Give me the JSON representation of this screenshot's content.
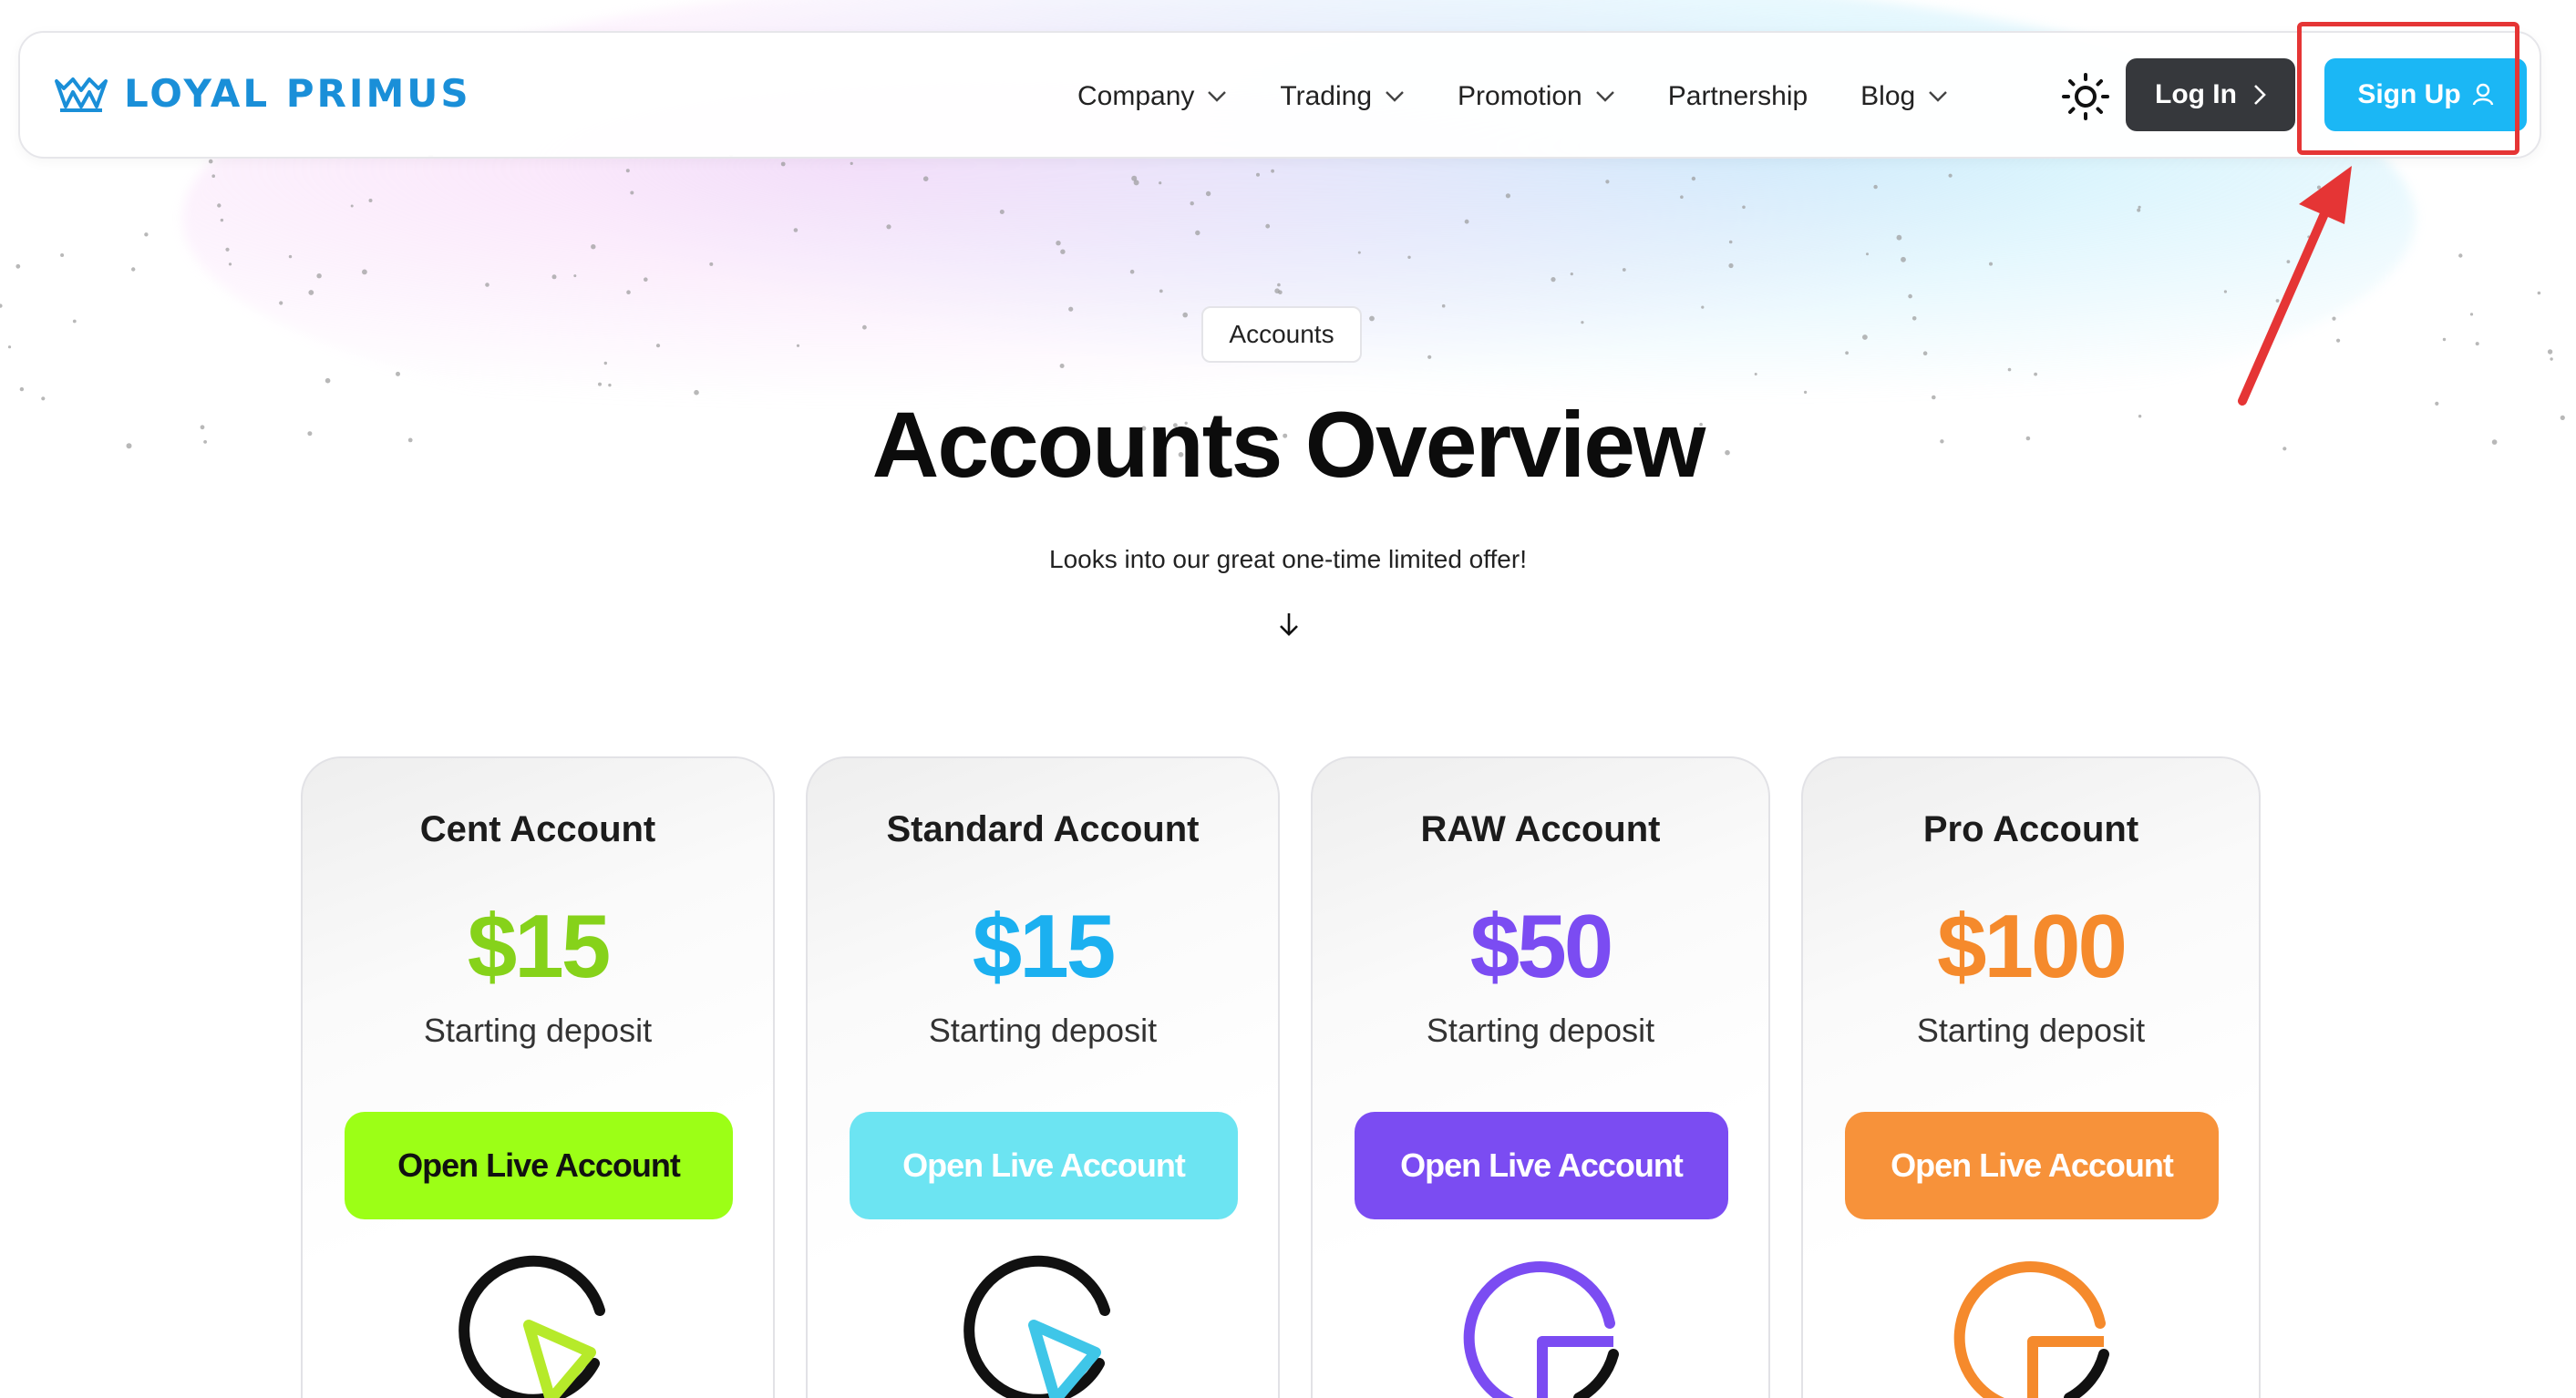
{
  "brand": {
    "name": "LOYAL PRIMUS",
    "color": "#1a8fd8"
  },
  "nav": {
    "items": [
      {
        "label": "Company",
        "has_dropdown": true
      },
      {
        "label": "Trading",
        "has_dropdown": true
      },
      {
        "label": "Promotion",
        "has_dropdown": true
      },
      {
        "label": "Partnership",
        "has_dropdown": false
      },
      {
        "label": "Blog",
        "has_dropdown": true
      }
    ],
    "theme_icon": "sun-icon",
    "login_label": "Log In",
    "signup_label": "Sign Up"
  },
  "hero": {
    "badge": "Accounts",
    "title": "Accounts Overview",
    "subtitle": "Looks into our great one-time limited offer!"
  },
  "cards": [
    {
      "title": "Cent Account",
      "price": "$15",
      "sub": "Starting deposit",
      "button": "Open Live Account",
      "accent": "#86d21a",
      "button_bg": "#9cff16",
      "button_text": "#111111"
    },
    {
      "title": "Standard Account",
      "price": "$15",
      "sub": "Starting deposit",
      "button": "Open Live Account",
      "accent": "#1bb0f0",
      "button_bg": "#6ce4f2",
      "button_text": "#ffffff"
    },
    {
      "title": "RAW Account",
      "price": "$50",
      "sub": "Starting deposit",
      "button": "Open Live Account",
      "accent": "#7b4cf2",
      "button_bg": "#7b4cf2",
      "button_text": "#ffffff"
    },
    {
      "title": "Pro Account",
      "price": "$100",
      "sub": "Starting deposit",
      "button": "Open Live Account",
      "accent": "#f58a2c",
      "button_bg": "#f7923a",
      "button_text": "#ffffff"
    }
  ],
  "annotation": {
    "color": "#e53535"
  }
}
